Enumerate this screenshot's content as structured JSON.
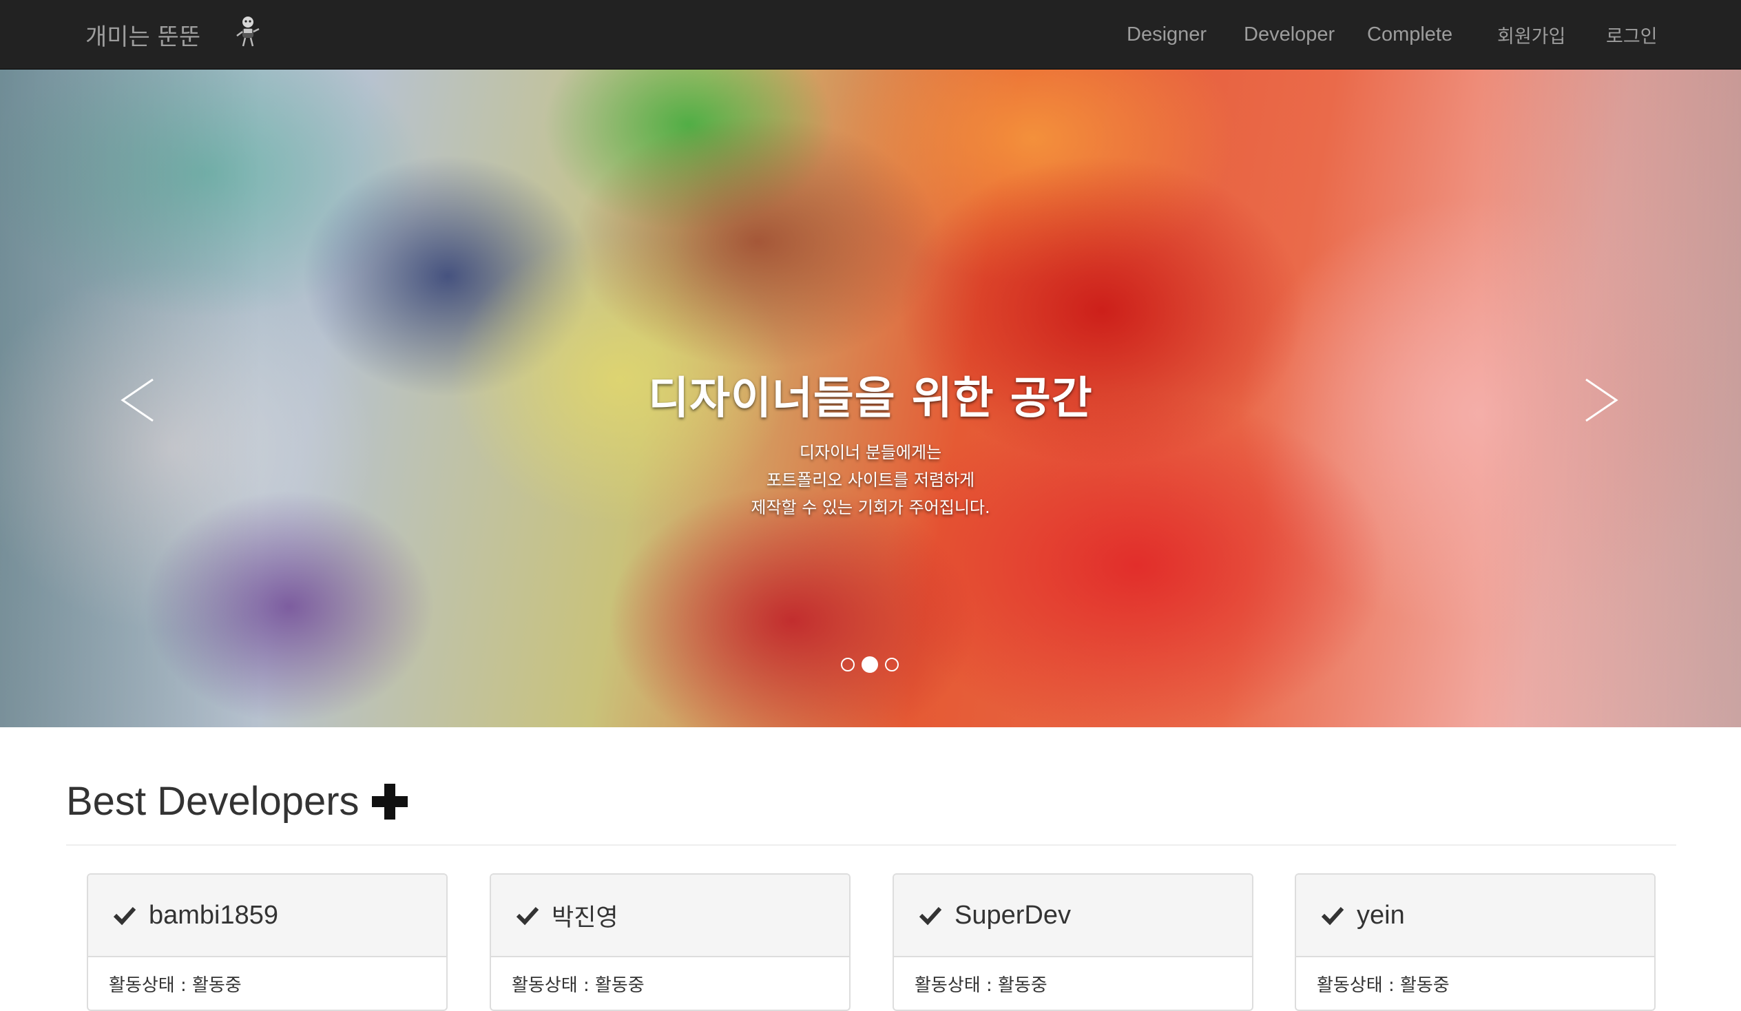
{
  "navbar": {
    "brand": "개미는 뚠뚠",
    "logo_icon": "ant-mascot-icon",
    "items": [
      {
        "label": "Designer"
      },
      {
        "label": "Developer"
      },
      {
        "label": "Complete"
      },
      {
        "label": "회원가입"
      },
      {
        "label": "로그인"
      }
    ]
  },
  "carousel": {
    "title": "디자이너들을 위한 공간",
    "lines": [
      "디자이너 분들에게는",
      "포트폴리오 사이트를 저렴하게",
      "제작할 수 있는 기회가 주어집니다."
    ],
    "prev_icon": "chevron-left-icon",
    "next_icon": "chevron-right-icon",
    "active_slide": 2,
    "slide_count": 3
  },
  "section": {
    "title": "Best Developers",
    "plus_icon": "plus-icon"
  },
  "cards": [
    {
      "name": "bambi1859",
      "status": "활동상태 : 활동중"
    },
    {
      "name": "박진영",
      "status": "활동상태 : 활동중"
    },
    {
      "name": "SuperDev",
      "status": "활동상태 : 활동중"
    },
    {
      "name": "yein",
      "status": "활동상태 : 활동중"
    }
  ]
}
